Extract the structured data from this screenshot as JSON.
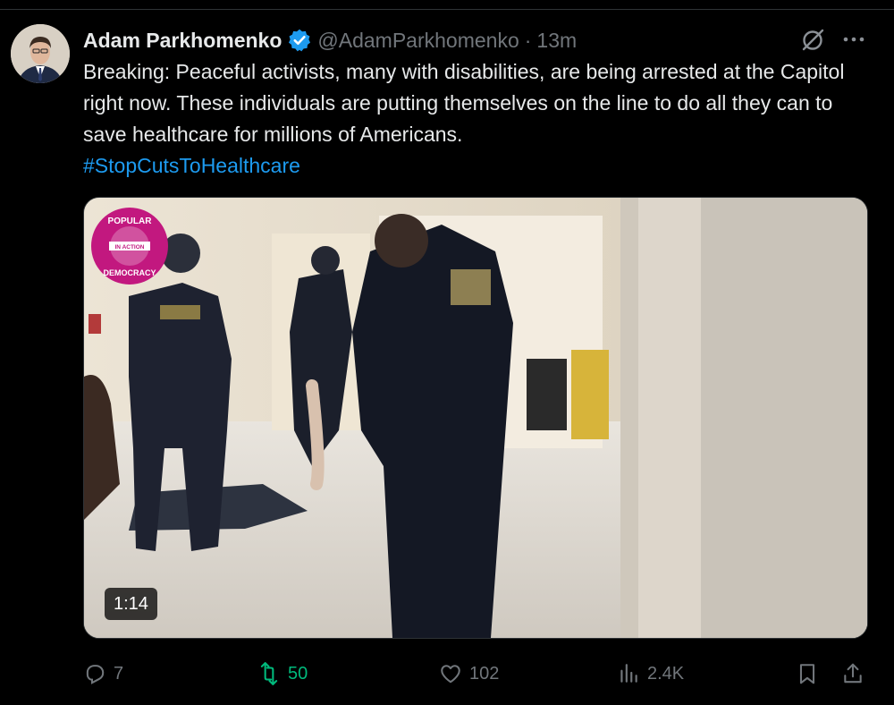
{
  "author": {
    "name": "Adam Parkhomenko",
    "handle": "@AdamParkhomenko",
    "separator": "·",
    "time": "13m",
    "verified_color": "#1d9bf0"
  },
  "tweet": {
    "text": "Breaking: Peaceful activists, many with disabilities, are being arrested at the Capitol right now. These individuals are putting themselves on the line to do all they can to  save healthcare for millions of Americans.",
    "hashtag": "#StopCutsToHealthcare"
  },
  "media": {
    "type": "video",
    "duration": "1:14",
    "logo_text_top": "POPULAR",
    "logo_text_middle": "IN ACTION",
    "logo_text_bottom": "DEMOCRACY"
  },
  "actions": {
    "replies": "7",
    "reposts": "50",
    "likes": "102",
    "views": "2.4K",
    "repost_color": "#00ba7c",
    "icons": [
      "reply-icon",
      "repost-icon",
      "like-icon",
      "views-icon",
      "bookmark-icon",
      "share-icon"
    ]
  },
  "header_icons": [
    "grok-icon",
    "more-icon"
  ]
}
